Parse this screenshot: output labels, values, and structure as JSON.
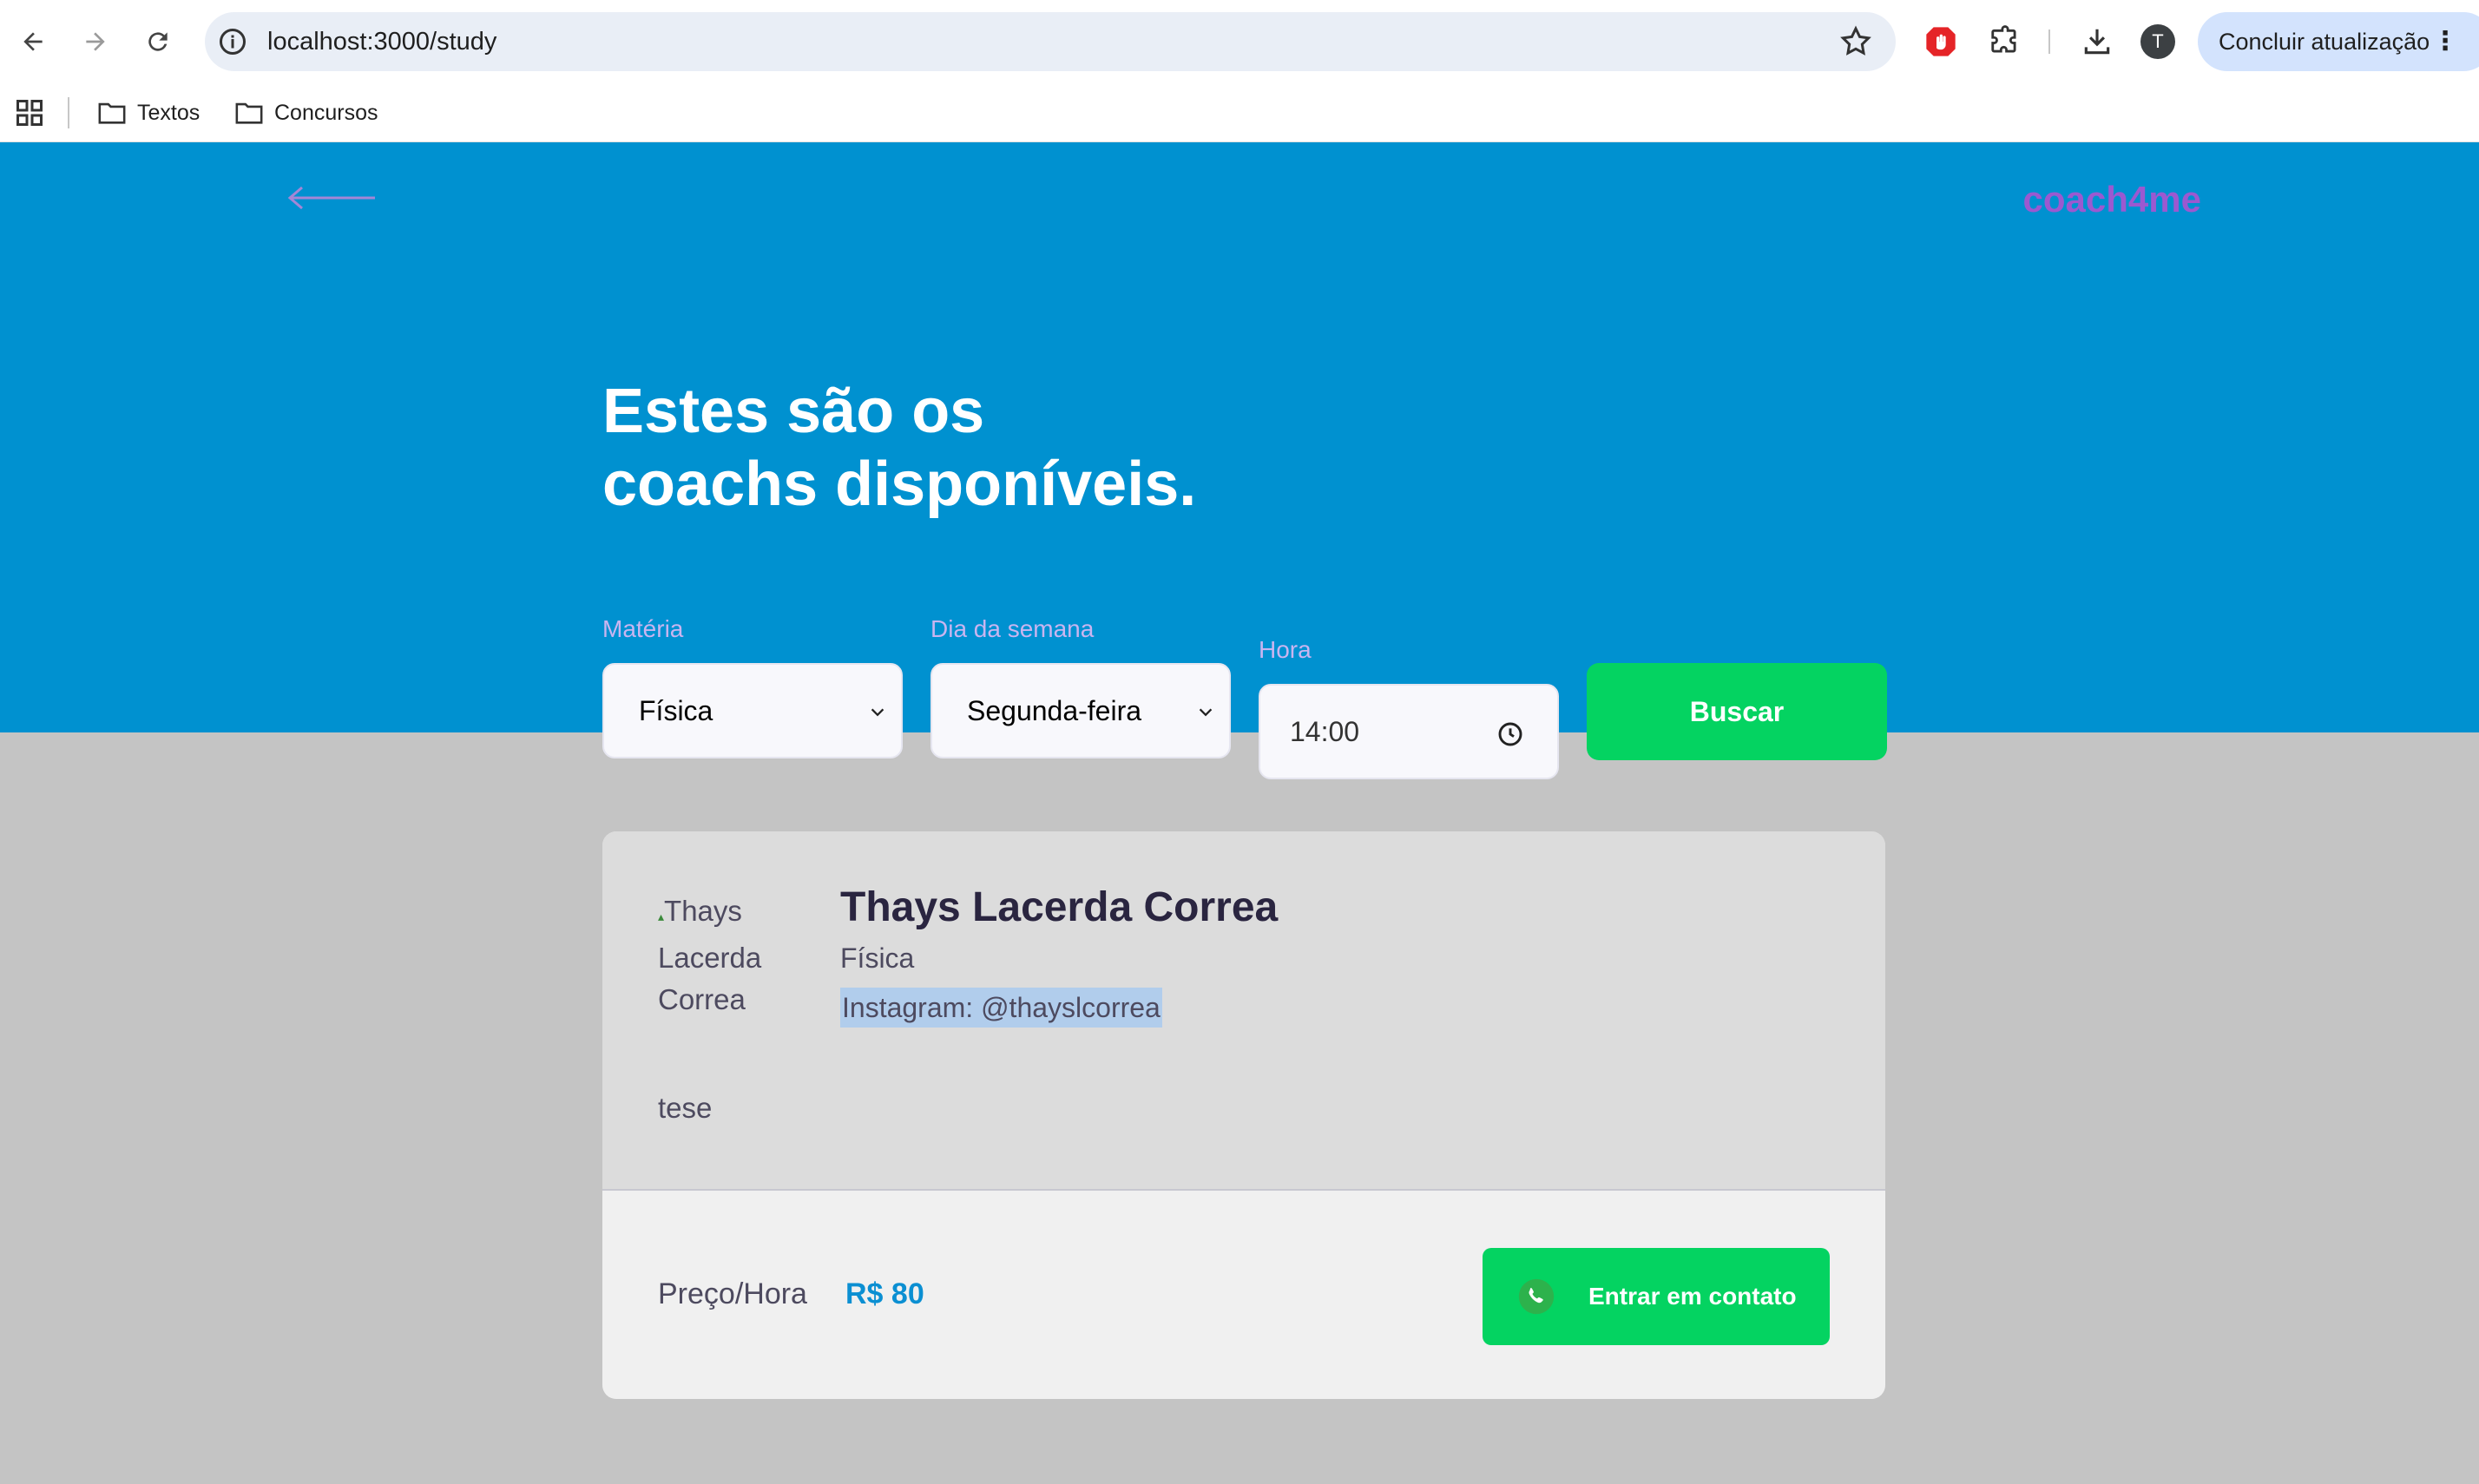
{
  "browser": {
    "url": "localhost:3000/study",
    "update_label": "Concluir atualização",
    "profile_initial": "T",
    "bookmarks": [
      "Textos",
      "Concursos"
    ]
  },
  "header": {
    "brand": "coach4me"
  },
  "hero": {
    "title_line1": "Estes são os",
    "title_line2": "coachs disponíveis."
  },
  "filters": {
    "subject_label": "Matéria",
    "subject_value": "Física",
    "weekday_label": "Dia da semana",
    "weekday_value": "Segunda-feira",
    "time_label": "Hora",
    "time_value": "14:00",
    "search_label": "Buscar"
  },
  "coach": {
    "avatar_alt": "Thays Lacerda Correa",
    "name": "Thays Lacerda Correa",
    "subject": "Física",
    "instagram": "Instagram: @thayslcorrea",
    "bio": "tese",
    "price_label": "Preço/Hora",
    "price_value": "R$ 80",
    "contact_label": "Entrar em contato"
  },
  "colors": {
    "hero_bg": "#0091d0",
    "accent_green": "#04d361",
    "brand_purple": "#9b59d0"
  }
}
